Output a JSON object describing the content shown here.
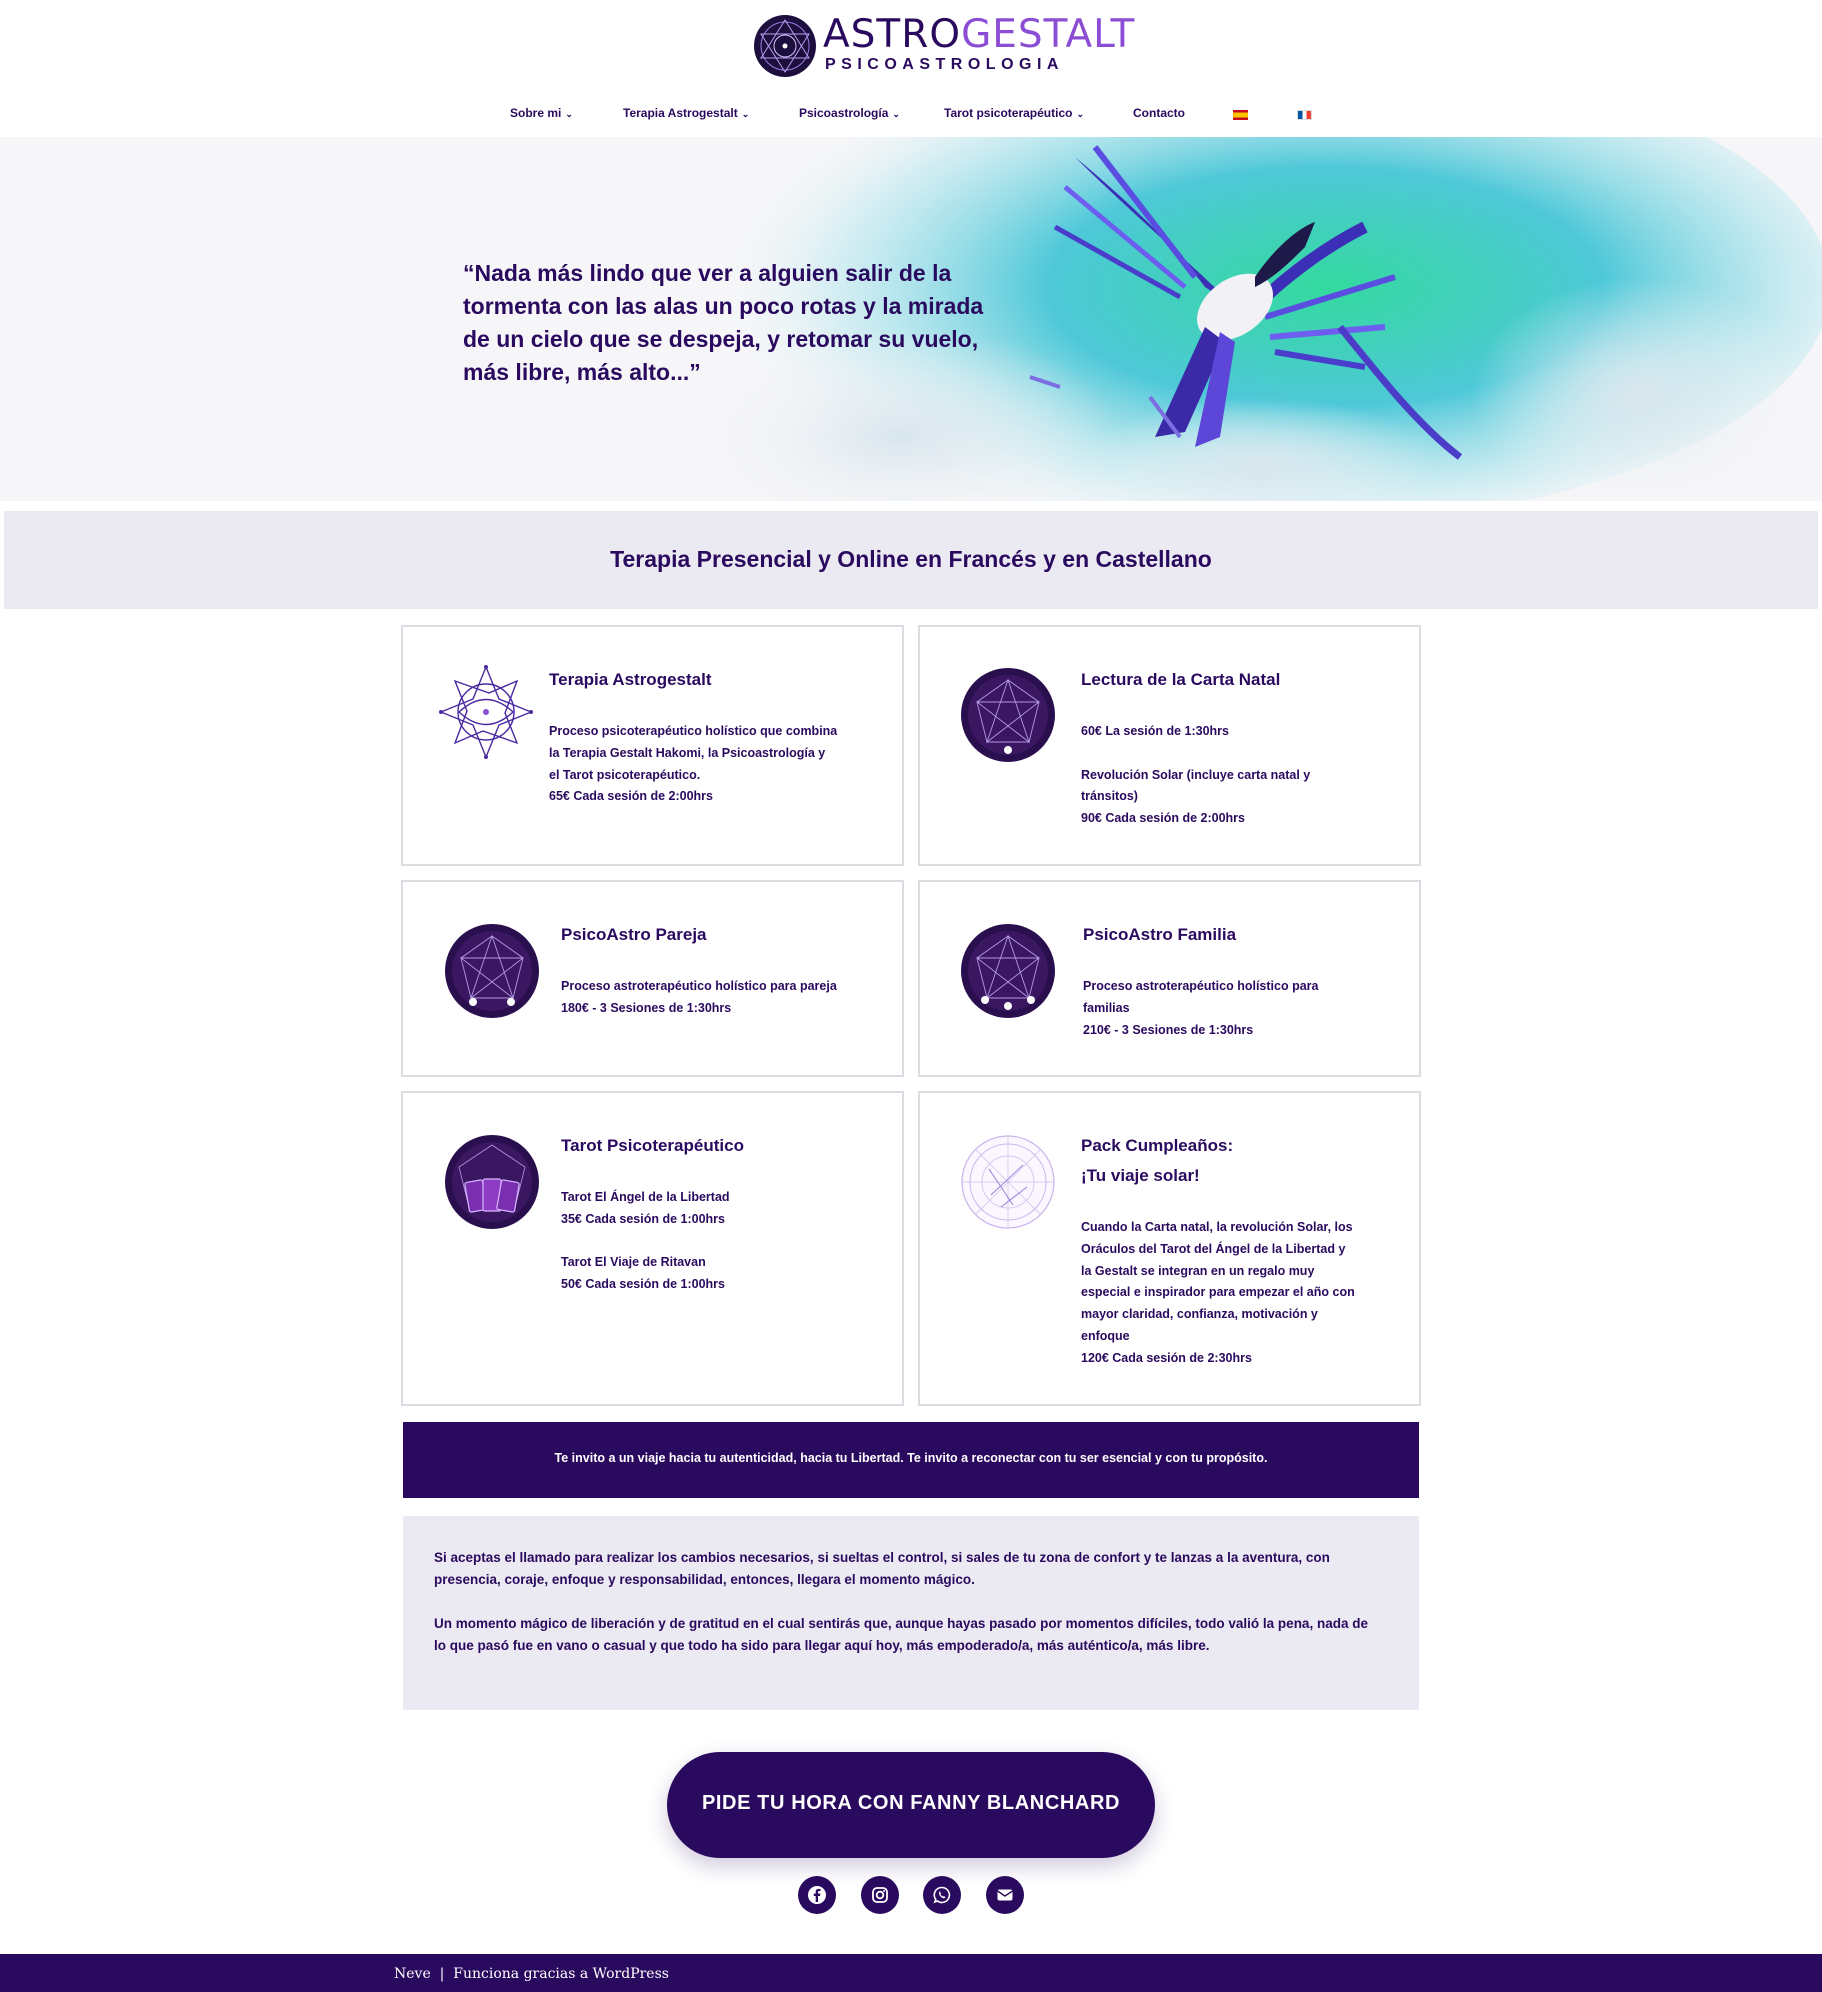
{
  "brand": {
    "title_part1": "ASTRO",
    "title_part2": "GESTALT",
    "subtitle": "PSICOASTROLOGIA"
  },
  "nav": {
    "items": [
      {
        "label": "Sobre mi",
        "dropdown": true
      },
      {
        "label": "Terapia Astrogestalt",
        "dropdown": true
      },
      {
        "label": "Psicoastrología",
        "dropdown": true
      },
      {
        "label": "Tarot psicoterapéutico",
        "dropdown": true
      },
      {
        "label": "Contacto",
        "dropdown": false
      }
    ],
    "languages": [
      "es-flag",
      "fr-flag"
    ]
  },
  "hero": {
    "quote": "“Nada más lindo que ver a alguien salir de la tormenta con las alas un poco rotas y la mirada de un cielo que se despeja, y retomar su vuelo, más libre, más alto...”"
  },
  "banner": {
    "title": "Terapia Presencial y Online en Francés y en Castellano"
  },
  "cards": [
    {
      "title": "Terapia Astrogestalt",
      "icon": "star-mandala-icon",
      "lines": [
        "Proceso psicoterapéutico holístico que combina",
        "la Terapia Gestalt Hakomi, la Psicoastrología y",
        "el Tarot psicoterapéutico.",
        "65€ Cada sesión de 2:00hrs"
      ]
    },
    {
      "title": "Lectura de la Carta Natal",
      "icon": "natal-chart-icon",
      "lines": [
        "60€ La sesión de 1:30hrs",
        "",
        "Revolución Solar (incluye carta natal y",
        "tránsitos)",
        "90€ Cada sesión de 2:00hrs"
      ]
    },
    {
      "title": "PsicoAstro Pareja",
      "icon": "couple-icon",
      "lines": [
        "Proceso astroterapéutico holístico para pareja",
        "180€ - 3 Sesiones de 1:30hrs"
      ]
    },
    {
      "title": "PsicoAstro Familia",
      "icon": "family-icon",
      "lines": [
        "Proceso astroterapéutico holístico para",
        "familias",
        "210€ - 3 Sesiones de 1:30hrs"
      ]
    },
    {
      "title": "Tarot Psicoterapéutico",
      "icon": "tarot-cards-icon",
      "lines": [
        "Tarot El Ángel de la Libertad",
        "35€ Cada sesión de 1:00hrs",
        "",
        "Tarot El Viaje de Ritavan",
        "50€ Cada sesión de 1:00hrs"
      ]
    },
    {
      "title": "Pack Cumpleaños:",
      "title2": "¡Tu viaje solar!",
      "icon": "astrology-wheel-icon",
      "lines": [
        "Cuando la Carta natal, la revolución Solar, los",
        "Oráculos del Tarot del Ángel de la Libertad y",
        "la Gestalt se integran en un regalo muy",
        "especial e inspirador para empezar el año con",
        "mayor claridad, confianza, motivación y",
        "enfoque",
        "120€ Cada sesión de 2:30hrs"
      ]
    }
  ],
  "invite": {
    "text": "Te invito a un viaje hacia tu autenticidad, hacia tu Libertad. Te invito a reconectar con tu ser esencial y con tu propósito."
  },
  "paragraphs": [
    "Si aceptas el llamado para realizar los cambios necesarios, si sueltas el control, si sales de tu zona de confort y te lanzas a la aventura, con presencia, coraje, enfoque y responsabilidad, entonces, llegara el momento mágico.",
    "Un momento mágico de liberación y de gratitud en el cual sentirás que, aunque hayas pasado por momentos difíciles, todo valió la pena, nada de lo que pasó fue en vano o casual y que todo ha sido para llegar aquí hoy, más empoderado/a, más auténtico/a, más libre."
  ],
  "cta": {
    "label": "PIDE TU HORA CON FANNY BLANCHARD"
  },
  "social": [
    "facebook-icon",
    "instagram-icon",
    "whatsapp-icon",
    "email-icon"
  ],
  "footer": {
    "theme": "Neve",
    "separator": "|",
    "powered": "Funciona gracias a WordPress"
  },
  "colors": {
    "primary": "#2a0a5e",
    "accent": "#8a4dd4",
    "light_bg": "#ebe9f1",
    "hero_teal": "#3fd8b0"
  }
}
